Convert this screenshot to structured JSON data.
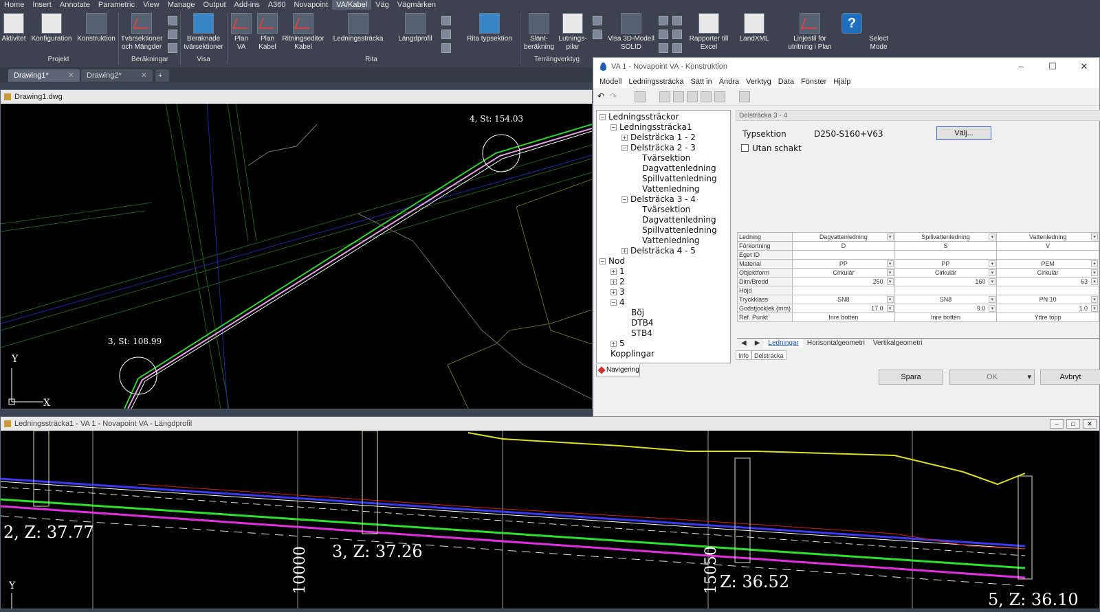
{
  "ribbon": {
    "tabs": [
      "Home",
      "Insert",
      "Annotate",
      "Parametric",
      "View",
      "Manage",
      "Output",
      "Add-ins",
      "A360",
      "Novapoint",
      "VA/Kabel",
      "Väg",
      "Vägmärken"
    ],
    "active_tab": "VA/Kabel",
    "tools": {
      "aktivitet": "Aktivitet",
      "konfiguration": "Konfiguration",
      "konstruktion": "Konstruktion",
      "tvarsektioner": "Tvärsektioner\noch Mängder",
      "beraknade": "Beräknade\ntvärsektioner",
      "plan_va": "Plan\nVA",
      "plan_kabel": "Plan\nKabel",
      "ritningseditor": "Ritningseditor\nKabel",
      "ledningsstracka": "Ledningssträcka",
      "langdprofil": "Längdprofil",
      "rita_typsektion": "Rita typsektion",
      "slant": "Slänt-\nberäkning",
      "lutningspilar": "Lutnings-\npilar",
      "visa3d": "Visa 3D-Modell\nSOLID",
      "rapporter": "Rapporter till\nExcel",
      "landxml": "LandXML",
      "linjestil": "Linjestil för\nutritning i Plan",
      "select_mode": "Select\nMode"
    },
    "groups": {
      "projekt": "Projekt",
      "berakningar": "Beräkningar",
      "visa": "Visa",
      "rita": "Rita",
      "terrangverktyg": "Terrängverktyg"
    }
  },
  "doc_tabs": [
    "Drawing1*",
    "Drawing2*"
  ],
  "drawing_window": {
    "title": "Drawing1.dwg",
    "labels": {
      "node4": "4, St: 154.03",
      "node3": "3, St: 108.99"
    },
    "axis_y": "Y",
    "axis_x": "X"
  },
  "profile_window": {
    "title": "Ledningssträcka1 - VA 1 - Novapoint VA - Längdprofil",
    "labels": {
      "z2": "2, Z: 37.77",
      "z3": "3, Z: 37.26",
      "z4": "Z: 36.52",
      "z5": "5, Z: 36.10",
      "st100": "10000",
      "st150": "15050"
    },
    "axis_y": "Y"
  },
  "dialog": {
    "title": "VA 1 - Novapoint VA - Konstruktion",
    "menu": [
      "Modell",
      "Ledningssträcka",
      "Sätt in",
      "Ändra",
      "Verktyg",
      "Data",
      "Fönster",
      "Hjälp"
    ],
    "tree": {
      "root": "Ledningssträckor",
      "l1": "Ledningssträcka1",
      "d12": "Delsträcka 1 - 2",
      "d23": "Delsträcka 2 - 3",
      "d34": "Delsträcka 3 - 4",
      "d45": "Delsträcka 4 - 5",
      "tvar": "Tvärsektion",
      "dag": "Dagvattenledning",
      "spill": "Spillvattenledning",
      "vatten": "Vattenledning",
      "nod": "Nod",
      "n1": "1",
      "n2": "2",
      "n3": "3",
      "n4": "4",
      "n5": "5",
      "boj": "Böj",
      "dtb4": "DTB4",
      "stb4": "STB4",
      "kopplingar": "Kopplingar"
    },
    "nav_tab": "Navigering",
    "panel_head": "Delsträcka 3 - 4",
    "typsektion_label": "Typsektion",
    "typsektion_value": "D250-S160+V63",
    "valj": "Välj...",
    "utan_schakt": "Utan schakt",
    "grid": {
      "rows": [
        {
          "h": "Ledning",
          "v": [
            "Dagvattenledning",
            "Spillvattenledning",
            "Vattenledning"
          ],
          "dd": true
        },
        {
          "h": "Förkortning",
          "v": [
            "D",
            "S",
            "V"
          ],
          "dd": false
        },
        {
          "h": "Eget ID",
          "v": [
            "",
            "",
            ""
          ],
          "dd": false
        },
        {
          "h": "Material",
          "v": [
            "PP",
            "PP",
            "PEM"
          ],
          "dd": true
        },
        {
          "h": "Objektform",
          "v": [
            "Cirkulär",
            "Cirkulär",
            "Cirkulär"
          ],
          "dd": true
        },
        {
          "h": "Dim/Bredd",
          "v": [
            "250",
            "160",
            "63"
          ],
          "dd": true,
          "right": true
        },
        {
          "h": "Höjd",
          "v": [
            "",
            "",
            ""
          ],
          "dd": false
        },
        {
          "h": "Tryckklass",
          "v": [
            "SN8",
            "SN8",
            "PN 10"
          ],
          "dd": true
        },
        {
          "h": "Godstjocklek (mm)",
          "v": [
            "17.0",
            "9.0",
            "1.0"
          ],
          "dd": true,
          "right": true
        },
        {
          "h": "Ref. Punkt",
          "v": [
            "Inre botten",
            "Inre botten",
            "Yttre topp"
          ],
          "dd": false
        }
      ]
    },
    "sub_tabs": [
      "Ledningar",
      "Horisontalgeometri",
      "Vertikalgeometri"
    ],
    "info_tabs": [
      "Info",
      "Delsträcka"
    ],
    "buttons": {
      "spara": "Spara",
      "ok": "OK",
      "avbryt": "Avbryt"
    }
  }
}
